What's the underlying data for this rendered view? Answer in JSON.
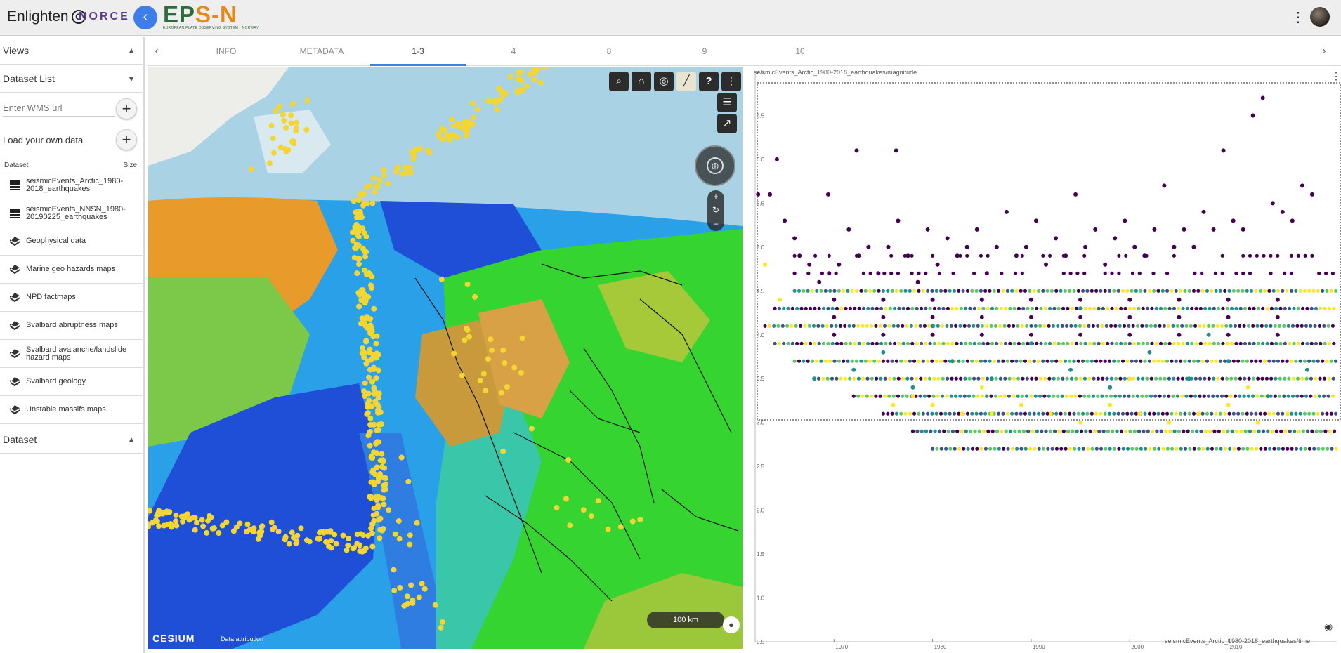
{
  "app": {
    "brand": "Enlighten",
    "brand_partner": "NORCE",
    "epos_title_prefix": "EP",
    "epos_title_mid": "S",
    "epos_title_suffix": "-N",
    "epos_subtitle": "EUROPEAN PLATE OBSERVING SYSTEM  ·  NORWAY",
    "more_icon": "more-vert-icon"
  },
  "sidebar": {
    "views_label": "Views",
    "dataset_list_label": "Dataset List",
    "wms_placeholder": "Enter WMS url",
    "load_label": "Load your own data",
    "col_dataset": "Dataset",
    "col_size": "Size",
    "items": [
      {
        "label": "seismicEvents_Arctic_1980-2018_earthquakes",
        "icon": "table-icon"
      },
      {
        "label": "seismicEvents_NNSN_1980-20190225_earthquakes",
        "icon": "table-icon"
      },
      {
        "label": "Geophysical data",
        "icon": "layers-icon"
      },
      {
        "label": "Marine geo hazards maps",
        "icon": "layers-icon"
      },
      {
        "label": "NPD factmaps",
        "icon": "layers-icon"
      },
      {
        "label": "Svalbard abruptness maps",
        "icon": "layers-icon"
      },
      {
        "label": "Svalbard avalanche/landslide hazard maps",
        "icon": "layers-icon"
      },
      {
        "label": "Svalbard geology",
        "icon": "layers-icon"
      },
      {
        "label": "Unstable massifs maps",
        "icon": "layers-icon"
      }
    ],
    "dataset_label": "Dataset"
  },
  "tabs": [
    {
      "label": "INFO"
    },
    {
      "label": "METADATA"
    },
    {
      "label": "1-3",
      "active": true
    },
    {
      "label": "4"
    },
    {
      "label": "8"
    },
    {
      "label": "9"
    },
    {
      "label": "10"
    }
  ],
  "map": {
    "scale_label": "100 km",
    "cesium_label": "CESIUM",
    "attribution_label": "Data attribution",
    "toolbar_icons": [
      "search-icon",
      "home-icon",
      "globe-icon",
      "map-mode-icon",
      "help-icon",
      "more-vert-icon"
    ],
    "colors": {
      "sea_light": "#a9d3e4",
      "land": "#ededea",
      "deep": "#1f4fd6",
      "mid": "#2aa0e8",
      "shelf": "#3ac6a8",
      "high": "#36d430",
      "orange": "#e89a2a",
      "events": "#f3d534"
    }
  },
  "chart": {
    "title": "seismicEvents_Arctic_1980-2018_earthquakes/magnitude",
    "x_title": "seismicEvents_Arctic_1980-2018_earthquakes/time",
    "colors": {
      "purple": "#440154",
      "teal": "#21908c",
      "blue": "#3b528b",
      "yellow": "#fde725",
      "green": "#5dc863"
    }
  },
  "chart_data": {
    "type": "scatter",
    "title": "seismicEvents_Arctic_1980-2018_earthquakes/magnitude",
    "xlabel": "seismicEvents_Arctic_1980-2018_earthquakes/time",
    "ylabel": "",
    "xlim": [
      1962,
      2021
    ],
    "ylim": [
      0.5,
      7.0
    ],
    "x_ticks": [
      "1970",
      "1980",
      "1990",
      "2000",
      "2010"
    ],
    "y_ticks": [
      "0.5",
      "1.0",
      "1.5",
      "2.0",
      "2.5",
      "3.0",
      "3.5",
      "4.0",
      "4.5",
      "5.0",
      "5.5",
      "6.0",
      "6.5",
      "7.0"
    ],
    "series": [
      {
        "values": [
          [
            1962.3,
            5.6
          ],
          [
            1963.5,
            5.6
          ],
          [
            1964.2,
            6.0
          ],
          [
            1965.0,
            5.3
          ],
          [
            1966.0,
            5.1
          ],
          [
            1969.4,
            5.6
          ],
          [
            1972.3,
            6.1
          ],
          [
            1976.3,
            6.1
          ],
          [
            1966.5,
            4.9
          ],
          [
            1967.5,
            4.8
          ],
          [
            1968.5,
            4.6
          ],
          [
            1969.5,
            4.7
          ],
          [
            1970.5,
            4.8
          ],
          [
            1971.5,
            5.2
          ],
          [
            1972.5,
            4.9
          ],
          [
            1973.5,
            5.0
          ],
          [
            1974.5,
            4.7
          ],
          [
            1975.5,
            5.0
          ],
          [
            1976.5,
            5.3
          ],
          [
            1977.5,
            4.9
          ],
          [
            1978.5,
            4.6
          ],
          [
            1979.5,
            5.2
          ],
          [
            1980.5,
            4.8
          ],
          [
            1981.5,
            5.1
          ],
          [
            1982.5,
            4.9
          ],
          [
            1983.5,
            5.0
          ],
          [
            1984.5,
            5.2
          ],
          [
            1985.5,
            4.7
          ],
          [
            1986.5,
            5.0
          ],
          [
            1987.5,
            5.4
          ],
          [
            1988.5,
            4.9
          ],
          [
            1989.5,
            5.0
          ],
          [
            1990.5,
            5.3
          ],
          [
            1991.5,
            4.8
          ],
          [
            1992.5,
            5.1
          ],
          [
            1993.5,
            4.9
          ],
          [
            1994.5,
            5.6
          ],
          [
            1995.5,
            5.0
          ],
          [
            1996.5,
            5.2
          ],
          [
            1997.5,
            4.8
          ],
          [
            1998.5,
            5.1
          ],
          [
            1999.5,
            5.3
          ],
          [
            2000.5,
            5.0
          ],
          [
            2001.5,
            4.9
          ],
          [
            2002.5,
            5.2
          ],
          [
            2003.5,
            5.7
          ],
          [
            2004.5,
            5.0
          ],
          [
            2005.5,
            5.2
          ],
          [
            2006.5,
            5.0
          ],
          [
            2007.5,
            5.4
          ],
          [
            2008.5,
            5.2
          ],
          [
            2009.5,
            6.1
          ],
          [
            2010.5,
            5.3
          ],
          [
            2011.5,
            5.2
          ],
          [
            2012.5,
            6.5
          ],
          [
            2013.5,
            6.7
          ],
          [
            2014.5,
            5.5
          ],
          [
            2015.5,
            5.4
          ],
          [
            2016.5,
            5.3
          ],
          [
            2017.5,
            5.7
          ],
          [
            2018.5,
            5.6
          ],
          [
            1970.0,
            4.4
          ],
          [
            1975.0,
            4.4
          ],
          [
            1980.0,
            4.4
          ],
          [
            1985.0,
            4.4
          ],
          [
            1990.0,
            4.4
          ],
          [
            1995.0,
            4.4
          ],
          [
            2000.0,
            4.4
          ],
          [
            2005.0,
            4.4
          ],
          [
            2010.0,
            4.4
          ],
          [
            2015.0,
            4.4
          ],
          [
            1970.0,
            4.2
          ],
          [
            1975.0,
            4.2
          ],
          [
            1980.0,
            4.2
          ],
          [
            1985.0,
            4.2
          ],
          [
            1990.0,
            4.2
          ],
          [
            1995.0,
            4.2
          ],
          [
            2000.0,
            4.2
          ],
          [
            2005.0,
            4.2
          ],
          [
            2010.0,
            4.2
          ],
          [
            2015.0,
            4.2
          ],
          [
            1970.0,
            4.0
          ],
          [
            1975.0,
            4.0
          ],
          [
            1980.0,
            4.0
          ],
          [
            1985.0,
            4.0
          ],
          [
            1990.0,
            4.0
          ],
          [
            1995.0,
            4.0
          ],
          [
            2000.0,
            4.0
          ],
          [
            2005.0,
            4.0
          ],
          [
            2010.0,
            4.0
          ],
          [
            2015.0,
            4.0
          ]
        ],
        "color": "#440154"
      },
      {
        "values": [
          [
            1968.0,
            3.5
          ],
          [
            1972.0,
            3.6
          ],
          [
            1975.0,
            3.8
          ],
          [
            1978.0,
            3.4
          ],
          [
            1982.0,
            3.7
          ],
          [
            1986.0,
            3.5
          ],
          [
            1990.0,
            3.9
          ],
          [
            1994.0,
            3.6
          ],
          [
            1998.0,
            3.4
          ],
          [
            2002.0,
            3.8
          ],
          [
            2006.0,
            3.5
          ],
          [
            2010.0,
            3.7
          ],
          [
            2014.0,
            3.3
          ],
          [
            2018.0,
            3.6
          ],
          [
            1980.0,
            4.1
          ],
          [
            1995.0,
            4.3
          ],
          [
            2008.0,
            4.0
          ]
        ],
        "color": "#21908c"
      },
      {
        "values": [
          [
            1963.0,
            4.8
          ],
          [
            1964.5,
            4.4
          ],
          [
            1976.0,
            3.2
          ],
          [
            1978.0,
            3.3
          ],
          [
            1980.0,
            3.2
          ],
          [
            1983.0,
            3.1
          ],
          [
            1986.0,
            3.1
          ],
          [
            1989.0,
            3.2
          ],
          [
            1992.0,
            3.1
          ],
          [
            1995.0,
            3.0
          ],
          [
            1998.0,
            3.2
          ],
          [
            2001.0,
            3.1
          ],
          [
            2004.0,
            3.0
          ],
          [
            2007.0,
            3.1
          ],
          [
            2010.0,
            3.2
          ],
          [
            2013.0,
            3.0
          ],
          [
            2016.0,
            3.1
          ],
          [
            1985.0,
            3.4
          ],
          [
            2000.0,
            3.5
          ],
          [
            2012.0,
            3.4
          ]
        ],
        "color": "#fde725"
      }
    ]
  }
}
